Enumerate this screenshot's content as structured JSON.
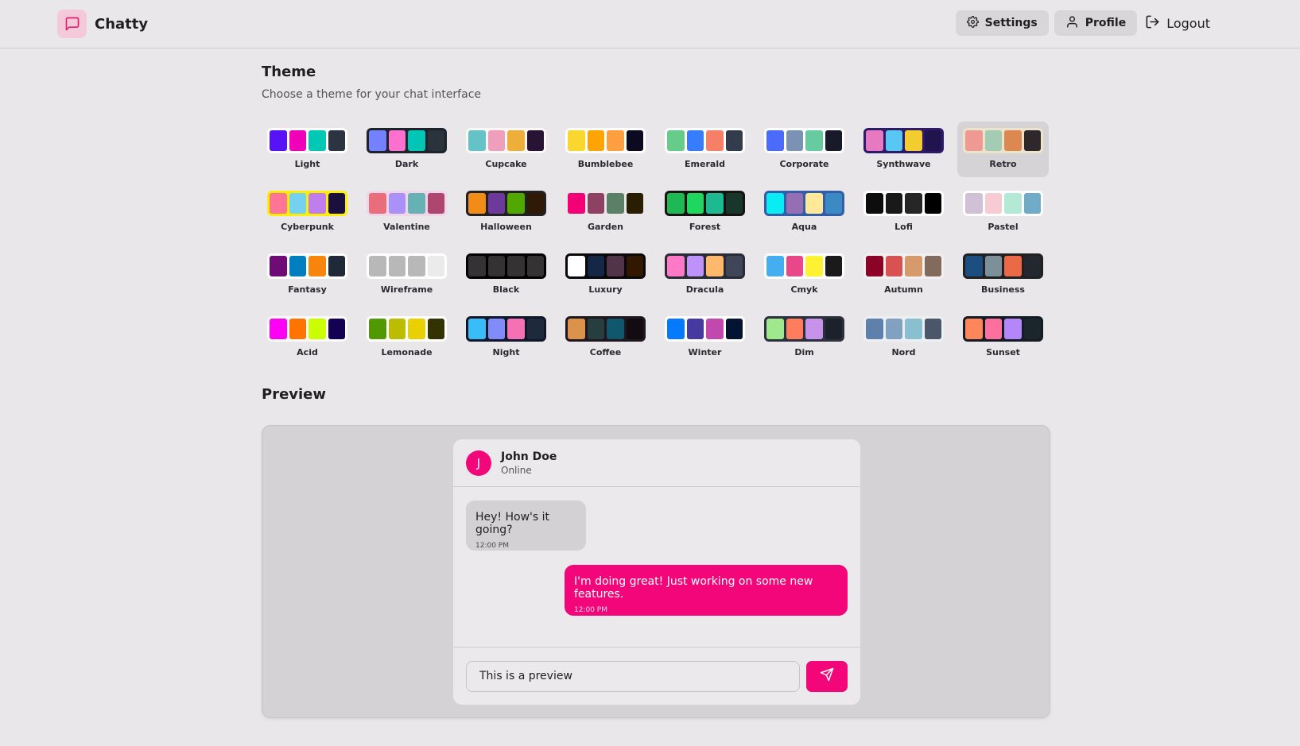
{
  "header": {
    "app_name": "Chatty",
    "settings_label": "Settings",
    "profile_label": "Profile",
    "logout_label": "Logout"
  },
  "theme": {
    "title": "Theme",
    "subtitle": "Choose a theme for your chat interface",
    "selected": "Retro",
    "themes": [
      {
        "name": "Light",
        "frame": "#ffffff",
        "swatches": [
          "#5712f6",
          "#f000b8",
          "#00c8b4",
          "#2b3440"
        ]
      },
      {
        "name": "Dark",
        "frame": "#1d232a",
        "swatches": [
          "#7582ff",
          "#ff71cf",
          "#00c7b5",
          "#2a323c"
        ]
      },
      {
        "name": "Cupcake",
        "frame": "#faf7f5",
        "swatches": [
          "#65c3c8",
          "#ef9fbc",
          "#eeaf3a",
          "#291334"
        ]
      },
      {
        "name": "Bumblebee",
        "frame": "#ffffff",
        "swatches": [
          "#f9d72f",
          "#ffa400",
          "#ff9f40",
          "#0c0a20"
        ]
      },
      {
        "name": "Emerald",
        "frame": "#ffffff",
        "swatches": [
          "#66cc8a",
          "#377cfb",
          "#f68067",
          "#333c4d"
        ]
      },
      {
        "name": "Corporate",
        "frame": "#ffffff",
        "swatches": [
          "#4b6bfb",
          "#7b92b2",
          "#67cba0",
          "#181a2a"
        ]
      },
      {
        "name": "Synthwave",
        "frame": "#2d1b69",
        "swatches": [
          "#e779c1",
          "#58c7f3",
          "#f3cc30",
          "#20134e"
        ]
      },
      {
        "name": "Retro",
        "frame": "#ece3ca",
        "swatches": [
          "#ef9995",
          "#a4cbb4",
          "#dc8850",
          "#2e282a"
        ]
      },
      {
        "name": "Cyberpunk",
        "frame": "#ffee00",
        "swatches": [
          "#ff7598",
          "#75d1f0",
          "#c07eec",
          "#1a103d"
        ]
      },
      {
        "name": "Valentine",
        "frame": "#f0d6e8",
        "swatches": [
          "#e96d7b",
          "#a991f7",
          "#66b1b3",
          "#af4670"
        ]
      },
      {
        "name": "Halloween",
        "frame": "#212121",
        "swatches": [
          "#f28c18",
          "#6d3a9c",
          "#51a800",
          "#2f1b05"
        ]
      },
      {
        "name": "Garden",
        "frame": "#e9e7e7",
        "swatches": [
          "#f40076",
          "#8e4162",
          "#5c7f67",
          "#291e00"
        ]
      },
      {
        "name": "Forest",
        "frame": "#171212",
        "swatches": [
          "#1eb854",
          "#1fd65f",
          "#1db990",
          "#19362d"
        ]
      },
      {
        "name": "Aqua",
        "frame": "#345da7",
        "swatches": [
          "#09ecf3",
          "#966fb3",
          "#ffe999",
          "#3b8ac4"
        ]
      },
      {
        "name": "Lofi",
        "frame": "#ffffff",
        "swatches": [
          "#0d0d0d",
          "#1a1919",
          "#262626",
          "#000000"
        ]
      },
      {
        "name": "Pastel",
        "frame": "#ffffff",
        "swatches": [
          "#d1c1d7",
          "#f6cbd1",
          "#b4e9d6",
          "#70acc7"
        ]
      },
      {
        "name": "Fantasy",
        "frame": "#ffffff",
        "swatches": [
          "#6e0b75",
          "#007ebd",
          "#f8860d",
          "#1f2937"
        ]
      },
      {
        "name": "Wireframe",
        "frame": "#ffffff",
        "swatches": [
          "#b8b8b8",
          "#b8b8b8",
          "#b8b8b8",
          "#ebebeb"
        ]
      },
      {
        "name": "Black",
        "frame": "#000000",
        "swatches": [
          "#343232",
          "#343232",
          "#343232",
          "#343232"
        ]
      },
      {
        "name": "Luxury",
        "frame": "#09090b",
        "swatches": [
          "#ffffff",
          "#152747",
          "#513448",
          "#331800"
        ]
      },
      {
        "name": "Dracula",
        "frame": "#282a36",
        "swatches": [
          "#ff79c6",
          "#bd93f9",
          "#ffb86c",
          "#414558"
        ]
      },
      {
        "name": "Cmyk",
        "frame": "#ffffff",
        "swatches": [
          "#45aeee",
          "#e8488a",
          "#fff232",
          "#1a1a1a"
        ]
      },
      {
        "name": "Autumn",
        "frame": "#f1f1f1",
        "swatches": [
          "#8c0327",
          "#d85251",
          "#d59b6a",
          "#826a5c"
        ]
      },
      {
        "name": "Business",
        "frame": "#202020",
        "swatches": [
          "#1c4e80",
          "#7c909a",
          "#ea6947",
          "#23282e"
        ]
      },
      {
        "name": "Acid",
        "frame": "#fafafa",
        "swatches": [
          "#ff00f4",
          "#ff7400",
          "#cbfd03",
          "#140151"
        ]
      },
      {
        "name": "Lemonade",
        "frame": "#ffffff",
        "swatches": [
          "#519903",
          "#bdbd00",
          "#e9d100",
          "#333300"
        ]
      },
      {
        "name": "Night",
        "frame": "#0f1729",
        "swatches": [
          "#38bdf8",
          "#818cf8",
          "#f471b5",
          "#1e293b"
        ]
      },
      {
        "name": "Coffee",
        "frame": "#20161f",
        "swatches": [
          "#db924b",
          "#263e3f",
          "#10576d",
          "#120c12"
        ]
      },
      {
        "name": "Winter",
        "frame": "#ffffff",
        "swatches": [
          "#057aff",
          "#463aa1",
          "#c149ad",
          "#021431"
        ]
      },
      {
        "name": "Dim",
        "frame": "#2a303c",
        "swatches": [
          "#9fe88d",
          "#ff7d5c",
          "#c792e9",
          "#1c212b"
        ]
      },
      {
        "name": "Nord",
        "frame": "#eceff4",
        "swatches": [
          "#5e81ac",
          "#81a1c1",
          "#88c0d0",
          "#4c566a"
        ]
      },
      {
        "name": "Sunset",
        "frame": "#121c22",
        "swatches": [
          "#ff865b",
          "#fd6f9c",
          "#b387fa",
          "#1b262c"
        ]
      }
    ]
  },
  "preview": {
    "title": "Preview",
    "contact_initial": "J",
    "contact_name": "John Doe",
    "contact_status": "Online",
    "messages": [
      {
        "text": "Hey! How's it going?",
        "time": "12:00 PM",
        "sent": false
      },
      {
        "text": "I'm doing great! Just working on some new features.",
        "time": "12:00 PM",
        "sent": true
      }
    ],
    "input_value": "This is a preview",
    "accent_color": "#f2067a"
  }
}
